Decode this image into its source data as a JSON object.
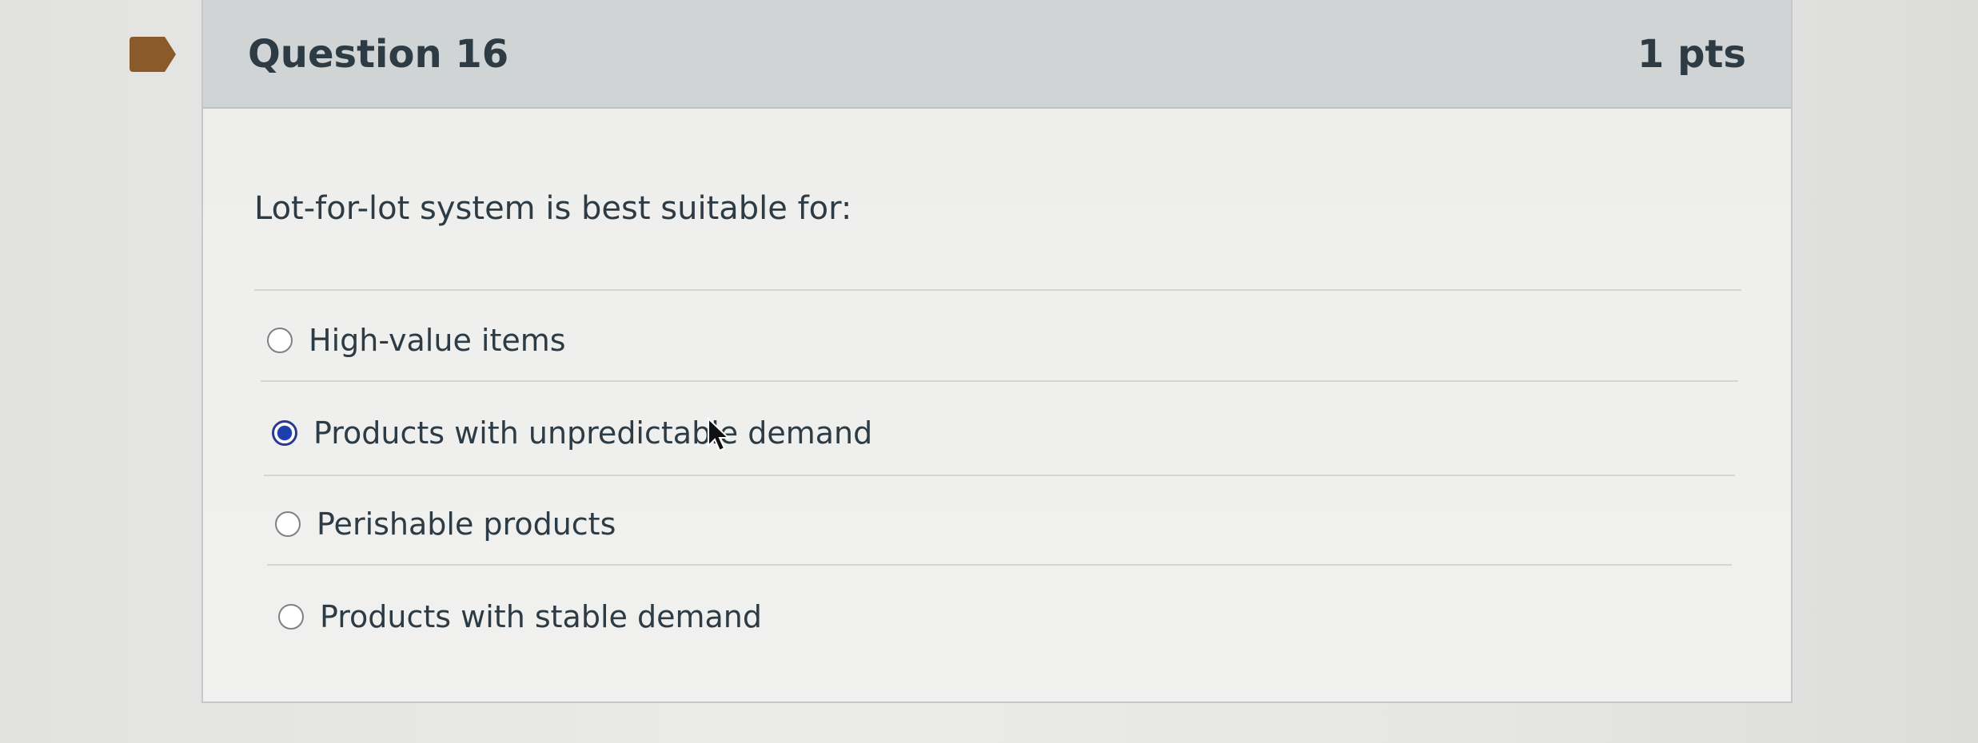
{
  "question": {
    "title": "Question 16",
    "points": "1 pts",
    "text": "Lot-for-lot system is best suitable for:",
    "answers": [
      {
        "label": "High-value items",
        "selected": false
      },
      {
        "label": "Products with unpredictable demand",
        "selected": true
      },
      {
        "label": "Perishable products",
        "selected": false
      },
      {
        "label": "Products with stable demand",
        "selected": false
      }
    ]
  },
  "colors": {
    "header_bg": "#d1d4d4",
    "bookmark": "#8b5a2b",
    "radio_selected": "#1c3fb0",
    "text": "#2d3b45"
  },
  "icons": {
    "bookmark": "flag-bookmark-icon",
    "cursor": "mouse-pointer-icon"
  }
}
